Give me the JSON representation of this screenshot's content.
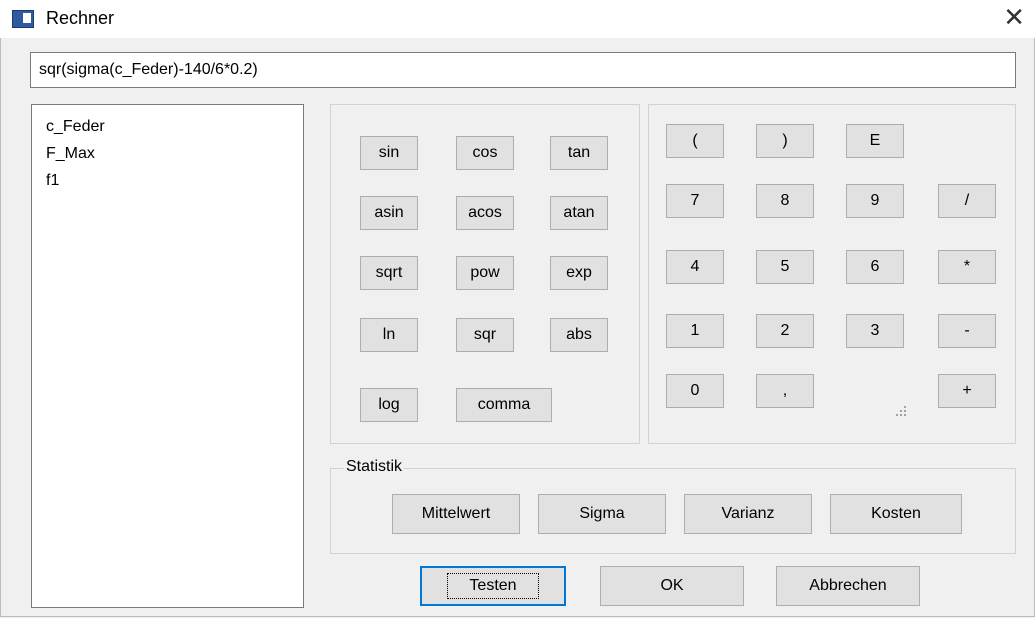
{
  "window": {
    "title": "Rechner",
    "close_glyph": "✕"
  },
  "formula": {
    "value": "sqr(sigma(c_Feder)-140/6*0.2)"
  },
  "variables": [
    "c_Feder",
    "F_Max",
    "f1"
  ],
  "functions": [
    "sin",
    "cos",
    "tan",
    "asin",
    "acos",
    "atan",
    "sqrt",
    "pow",
    "exp",
    "ln",
    "sqr",
    "abs",
    "log",
    "comma"
  ],
  "keypad": [
    "(",
    ")",
    "E",
    "7",
    "8",
    "9",
    "/",
    "4",
    "5",
    "6",
    "*",
    "1",
    "2",
    "3",
    "-",
    "0",
    ",",
    "+"
  ],
  "statistik": {
    "label": "Statistik",
    "buttons": [
      "Mittelwert",
      "Sigma",
      "Varianz",
      "Kosten"
    ]
  },
  "dialog_buttons": {
    "test": "Testen",
    "ok": "OK",
    "cancel": "Abbrechen"
  }
}
